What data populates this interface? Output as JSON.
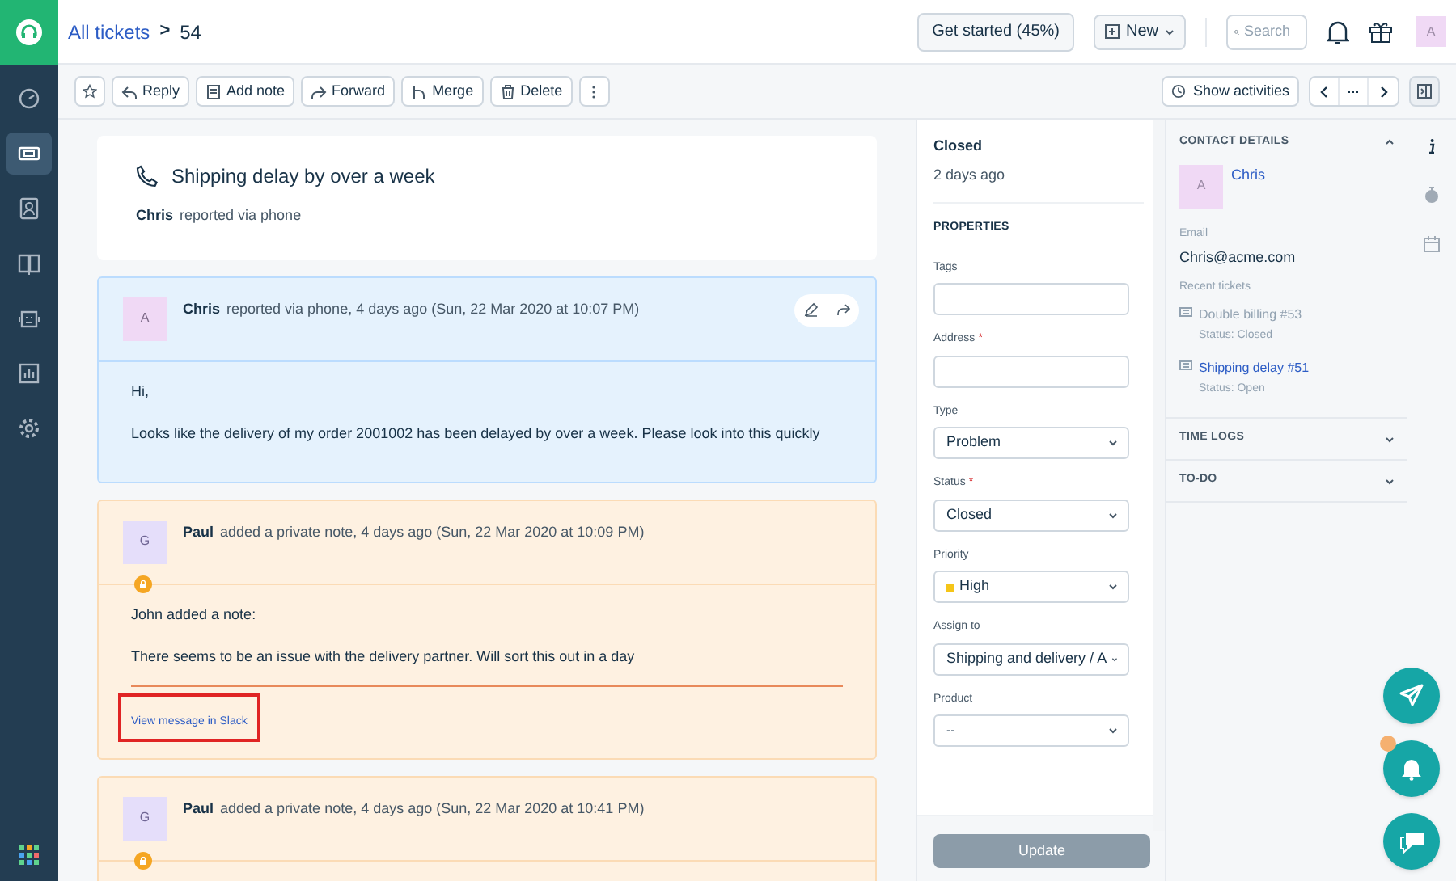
{
  "breadcrumb": {
    "link": "All tickets",
    "separator": ">",
    "current": "54"
  },
  "header": {
    "get_started": "Get started (45%)",
    "new_button": "New",
    "search": {
      "placeholder": "Search"
    },
    "avatar": "A"
  },
  "sidebar": {
    "items": [
      {
        "kind": "dashboard",
        "selected": false
      },
      {
        "kind": "tickets",
        "selected": true
      },
      {
        "kind": "contacts",
        "selected": false
      },
      {
        "kind": "knowledge",
        "selected": false
      },
      {
        "kind": "bot",
        "selected": false
      },
      {
        "kind": "reports",
        "selected": false
      },
      {
        "kind": "settings",
        "selected": false
      }
    ]
  },
  "toolbar": {
    "actions": [
      {
        "kind": "reply",
        "label": "Reply"
      },
      {
        "kind": "note",
        "label": "Add note"
      },
      {
        "kind": "forward",
        "label": "Forward"
      },
      {
        "kind": "merge",
        "label": "Merge"
      },
      {
        "kind": "delete",
        "label": "Delete"
      }
    ],
    "show_activities": "Show activities"
  },
  "ticket": {
    "title": "Shipping delay by over a week",
    "reporter": "Chris",
    "via": "reported via phone"
  },
  "messages": [
    {
      "kind": "reply",
      "avatar": "A",
      "author": "Chris",
      "meta": "reported via phone, 4 days ago (Sun, 22 Mar 2020 at 10:07 PM)",
      "body": [
        "Hi,",
        "Looks like the delivery of my order 2001002 has been delayed by over a week. Please look into this quickly"
      ]
    },
    {
      "kind": "private_note",
      "avatar": "G",
      "author": "Paul",
      "meta": "added a private note, 4 days ago (Sun, 22 Mar 2020 at 10:09 PM)",
      "body": [
        "John added a note:",
        "There seems to be an issue with the delivery partner. Will sort this out in a day"
      ],
      "link": "View message in Slack"
    },
    {
      "kind": "private_note",
      "avatar": "G",
      "author": "Paul",
      "meta": "added a private note, 4 days ago (Sun, 22 Mar 2020 at 10:41 PM)"
    }
  ],
  "properties": {
    "required_mark": "*",
    "state": "Closed",
    "time": "2 days ago",
    "heading": "PROPERTIES",
    "fields": [
      {
        "kind": "text",
        "label": "Tags",
        "required": false
      },
      {
        "kind": "text",
        "label": "Address",
        "required": true
      },
      {
        "kind": "select",
        "label": "Type",
        "required": false,
        "value": "Problem"
      },
      {
        "kind": "select",
        "label": "Status",
        "required": true,
        "value": "Closed"
      },
      {
        "kind": "select",
        "label": "Priority",
        "required": false,
        "value": "High",
        "color": "#f5c518"
      },
      {
        "kind": "select",
        "label": "Assign to",
        "required": false,
        "value": "Shipping and delivery / A"
      },
      {
        "kind": "select",
        "label": "Product",
        "required": false,
        "placeholder": "--"
      }
    ],
    "update_button": {
      "label": "Update",
      "disabled": true
    }
  },
  "contact": {
    "heading": "CONTACT DETAILS",
    "expanded": true,
    "avatar": "A",
    "name": "Chris",
    "email_label": "Email",
    "email": "Chris@acme.com",
    "recent_label": "Recent tickets",
    "recent_tickets": [
      {
        "title": "Double billing",
        "number": "#53",
        "status": "Status: Closed",
        "highlighted": false
      },
      {
        "title": "Shipping delay",
        "number": "#51",
        "status": "Status: Open",
        "highlighted": true
      }
    ]
  },
  "sections": [
    {
      "title": "TIME LOGS",
      "expanded": false
    },
    {
      "title": "TO-DO",
      "expanded": false
    }
  ],
  "notifications": {
    "unread": true
  }
}
